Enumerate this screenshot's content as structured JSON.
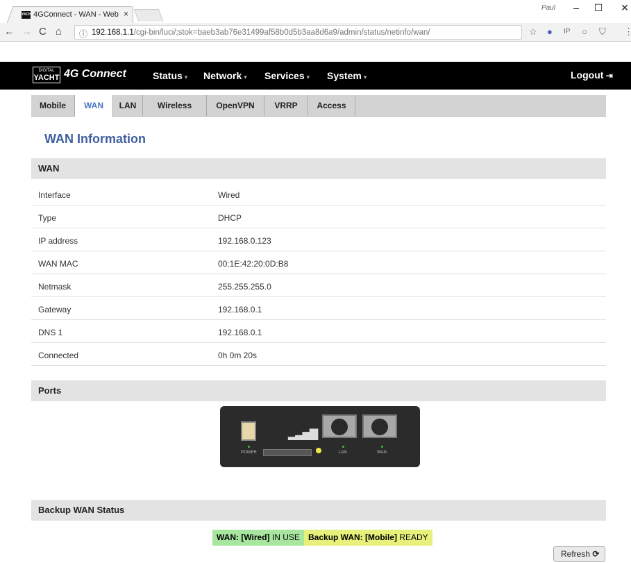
{
  "browser": {
    "tab_title": "4GConnect - WAN - Web",
    "tab_close": "×",
    "user": "Paul",
    "url_host": "192.168.1.1",
    "url_path": "/cgi-bin/luci/;stok=baeb3ab76e31499af58b0d5b3aa8d6a9/admin/status/netinfo/wan/",
    "favicon_text": "YACHT"
  },
  "header": {
    "logo_top": "DIGITAL",
    "logo_main": "YACHT",
    "brand": "4G Connect",
    "menus": [
      "Status",
      "Network",
      "Services",
      "System"
    ],
    "logout": "Logout"
  },
  "tabs": [
    "Mobile",
    "WAN",
    "LAN",
    "Wireless",
    "OpenVPN",
    "VRRP",
    "Access"
  ],
  "active_tab": "WAN",
  "page_title": "WAN Information",
  "wan_section": {
    "title": "WAN",
    "rows": [
      {
        "key": "Interface",
        "value": "Wired"
      },
      {
        "key": "Type",
        "value": "DHCP"
      },
      {
        "key": "IP address",
        "value": "192.168.0.123"
      },
      {
        "key": "WAN MAC",
        "value": "00:1E:42:20:0D:B8"
      },
      {
        "key": "Netmask",
        "value": "255.255.255.0"
      },
      {
        "key": "Gateway",
        "value": "192.168.0.1"
      },
      {
        "key": "DNS 1",
        "value": "192.168.0.1"
      },
      {
        "key": "Connected",
        "value": "0h 0m 20s"
      }
    ]
  },
  "ports_section": {
    "title": "Ports",
    "labels": {
      "power": "POWER",
      "lan": "LAN",
      "wan": "WAN"
    }
  },
  "backup_section": {
    "title": "Backup WAN Status",
    "wan_label": "WAN: [Wired]",
    "wan_state": "IN USE",
    "backup_label": "Backup WAN: [Mobile]",
    "backup_state": "READY",
    "wan_color": "#a8e6a0",
    "backup_color": "#e6f07a"
  },
  "refresh_label": "Refresh"
}
